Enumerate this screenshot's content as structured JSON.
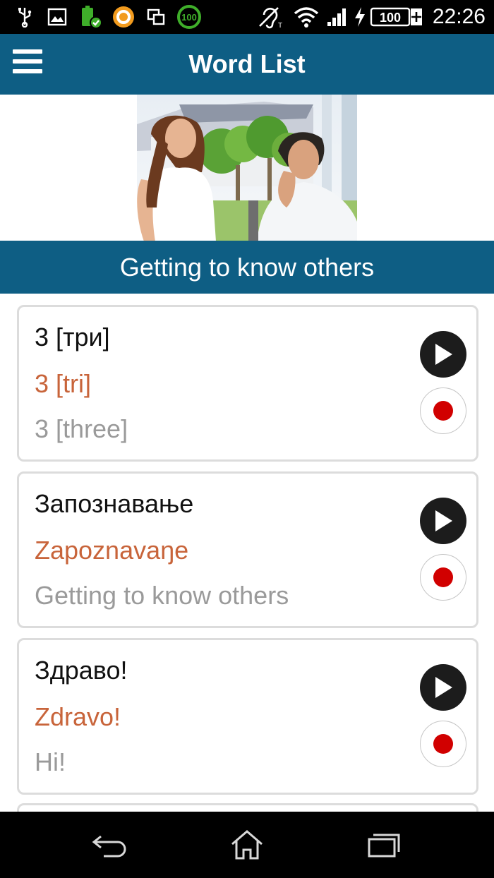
{
  "status_bar": {
    "time": "22:26",
    "battery_level": "100",
    "icons": [
      "usb-icon",
      "image-icon",
      "battery-check-icon",
      "orange-circle-icon",
      "screens-icon",
      "battery-100-icon",
      "hearing-aid-icon",
      "wifi-icon",
      "signal-icon",
      "charging-icon",
      "battery-icon"
    ]
  },
  "app_bar": {
    "title": "Word List",
    "menu_icon": "hamburger-menu-icon"
  },
  "section": {
    "title": "Getting to know others"
  },
  "words": [
    {
      "native": "3 [три]",
      "transliteration": "3 [tri]",
      "translation": "3 [three]"
    },
    {
      "native": "Запознавање",
      "transliteration": "Zapoznavaŋe",
      "translation": "Getting to know others"
    },
    {
      "native": "Здраво!",
      "transliteration": "Zdravo!",
      "translation": "Hi!"
    }
  ],
  "colors": {
    "primary": "#0e5e84",
    "transliteration": "#c8643a",
    "translation": "#9a9a9a",
    "record": "#d10000"
  },
  "nav_bar": {
    "icons": [
      "back-icon",
      "home-icon",
      "recent-apps-icon"
    ]
  }
}
